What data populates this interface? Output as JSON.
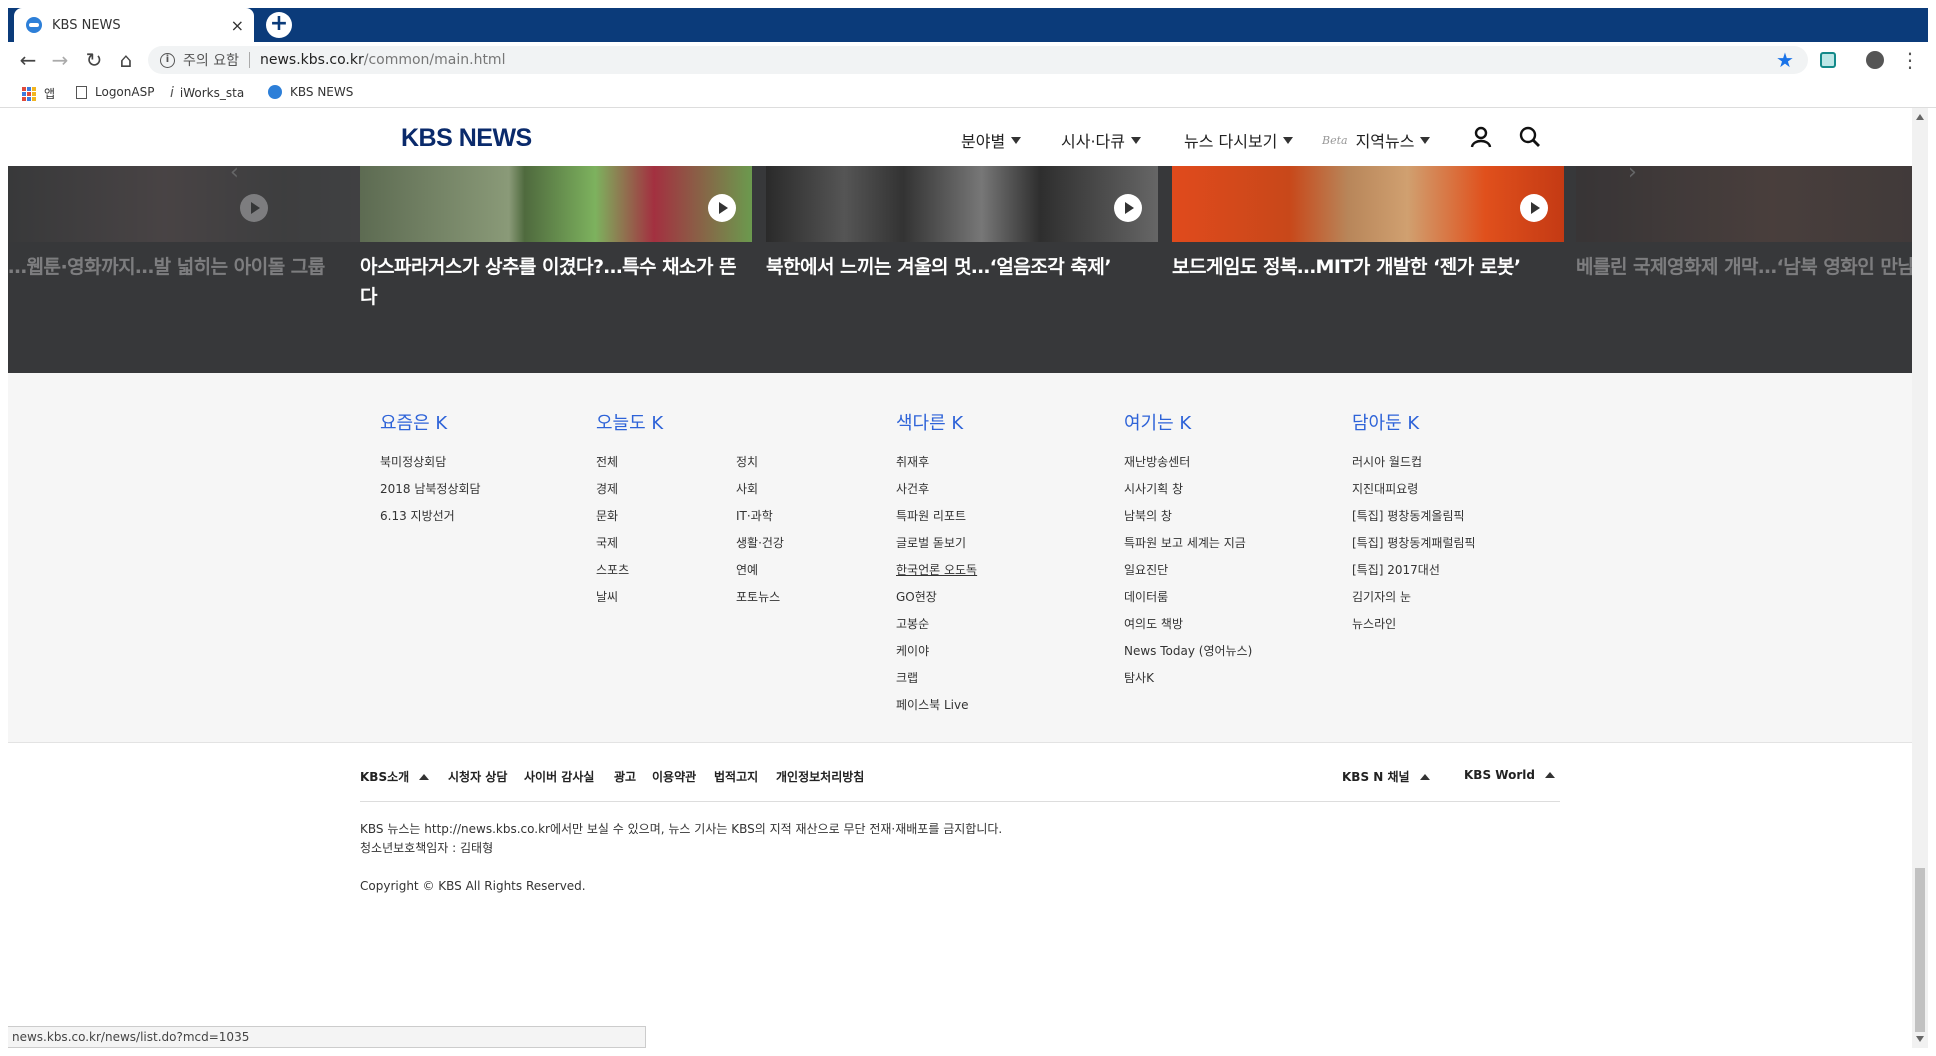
{
  "browser": {
    "tab_title": "KBS NEWS",
    "tab_close": "×",
    "new_tab": "+",
    "security_text": "주의 요함",
    "url_host": "news.kbs.co.kr",
    "url_path": "/common/main.html",
    "bookmarks": [
      "앱",
      "LogonASP",
      "iWorks_sta",
      "KBS NEWS"
    ],
    "status_url": "news.kbs.co.kr/news/list.do?mcd=1035"
  },
  "site": {
    "logo": "KBS NEWS",
    "nav": [
      "분야별",
      "시사·다큐",
      "뉴스 다시보기"
    ],
    "beta": "Beta",
    "regional": "지역뉴스"
  },
  "carousel": [
    "…웹툰·영화까지…발 넓히는 아이돌 그룹",
    "아스파라거스가 상추를 이겼다?…특수 채소가 뜬다",
    "북한에서 느끼는 겨울의 멋…‘얼음조각 축제’",
    "보드게임도 정복…MIT가 개발한 ‘젠가 로봇’",
    "베를린 국제영화제 개막…‘남북 영화인 만남’ 예정"
  ],
  "footer": {
    "col1": {
      "title": "요즘은 K",
      "links": [
        "북미정상회담",
        "2018 남북정상회담",
        "6.13 지방선거"
      ]
    },
    "col2": {
      "title": "오늘도 K",
      "links_a": [
        "전체",
        "경제",
        "문화",
        "국제",
        "스포츠",
        "날씨"
      ],
      "links_b": [
        "정치",
        "사회",
        "IT·과학",
        "생활·건강",
        "연예",
        "포토뉴스"
      ]
    },
    "col3": {
      "title": "색다른 K",
      "links": [
        "취재후",
        "사건후",
        "특파원 리포트",
        "글로벌 돋보기",
        "한국언론 오도독",
        "GO현장",
        "고봉순",
        "케이야",
        "크랩",
        "페이스북 Live"
      ]
    },
    "col4": {
      "title": "여기는 K",
      "links": [
        "재난방송센터",
        "시사기획 창",
        "남북의 창",
        "특파원 보고 세계는 지금",
        "일요진단",
        "데이터룸",
        "여의도 책방",
        "News Today (영어뉴스)",
        "탐사K"
      ]
    },
    "col5": {
      "title": "담아둔 K",
      "links": [
        "러시아 월드컵",
        "지진대피요령",
        "[특집] 평창동계올림픽",
        "[특집] 평창동계패럴림픽",
        "[특집] 2017대선",
        "김기자의 눈",
        "뉴스라인"
      ]
    },
    "bottom_links": [
      "KBS소개",
      "시청자 상담",
      "사이버 감사실",
      "광고",
      "이용약관",
      "법적고지",
      "개인정보처리방침"
    ],
    "channels": [
      "KBS N 채널",
      "KBS World"
    ],
    "legal1": "KBS 뉴스는 http://news.kbs.co.kr에서만 보실 수 있으며, 뉴스 기사는 KBS의 지적 재산으로 무단 전재·재배포를 금지합니다.",
    "legal2": "청소년보호책임자 : 김태형",
    "copyright": "Copyright © KBS All Rights Reserved."
  }
}
